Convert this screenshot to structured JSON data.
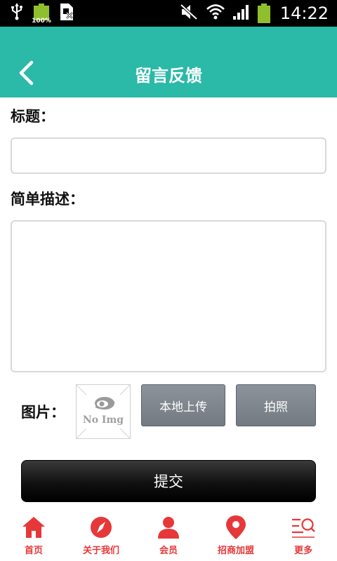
{
  "status_bar": {
    "battery_left_percent": "100%",
    "time": "14:22"
  },
  "header": {
    "title": "留言反馈"
  },
  "form": {
    "title_label": "标题：",
    "title_value": "",
    "description_label": "简单描述：",
    "description_value": "",
    "image_label": "图片：",
    "no_image_text": "No Img",
    "upload_local_label": "本地上传",
    "take_photo_label": "拍照",
    "submit_label": "提交"
  },
  "bottom_nav": {
    "items": [
      {
        "label": "首页",
        "icon": "home-icon"
      },
      {
        "label": "关于我们",
        "icon": "compass-icon"
      },
      {
        "label": "会员",
        "icon": "person-icon"
      },
      {
        "label": "招商加盟",
        "icon": "location-pin-icon"
      },
      {
        "label": "更多",
        "icon": "more-search-icon"
      }
    ]
  },
  "colors": {
    "header": "#2bb9a8",
    "nav_accent": "#e63838",
    "button_gray": "#7f868d",
    "submit_black": "#111111"
  }
}
